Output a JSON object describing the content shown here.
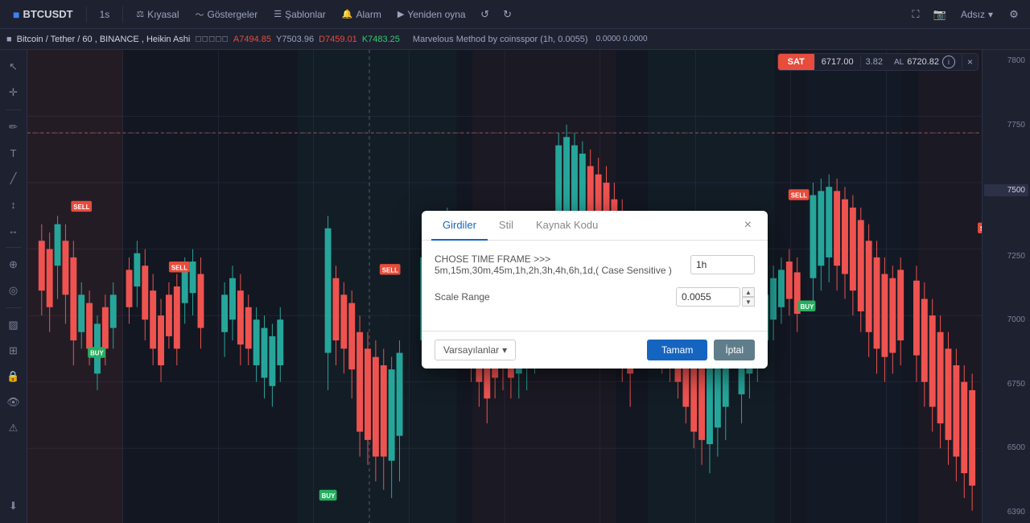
{
  "toolbar": {
    "symbol": "BTCUSDT",
    "timeframe": "1s",
    "kiyasal_label": "Kıyasal",
    "gostergeler_label": "Göstergeler",
    "sablonlar_label": "Şablonlar",
    "alarm_label": "Alarm",
    "yeniden_oyna_label": "Yeniden oyna",
    "adsiz_label": "Adsız"
  },
  "chart_info": {
    "symbol": "Bitcoin / Tether",
    "timeframe": "60",
    "exchange": "BINANCE",
    "type": "Heikin Ashi",
    "a_price": "A7494.85",
    "y_price": "Y7503.96",
    "d_price": "D7459.01",
    "k_price": "K7483.25",
    "indicator": "Marvelous Method by coinsspor (1h, 0.0055)"
  },
  "buy_sell_panel": {
    "sat_label": "SAT",
    "sat_price": "6717.00",
    "spread": "3.82",
    "al_label": "AL",
    "al_price": "6720.82"
  },
  "price_scale": {
    "levels": [
      "7800",
      "7750",
      "7500",
      "7250",
      "7000",
      "6750",
      "6500"
    ]
  },
  "dialog": {
    "title": "Girdiler",
    "tabs": [
      "Girdiler",
      "Stil",
      "Kaynak Kodu"
    ],
    "active_tab": 0,
    "fields": [
      {
        "label": "CHOSE TIME FRAME >>> 5m,15m,30m,45m,1h,2h,3h,4h,6h,1d,( Case Sensitive )",
        "value": "1h",
        "name": "timeframe-input"
      },
      {
        "label": "Scale Range",
        "value": "0.0055",
        "name": "scale-range-input"
      }
    ],
    "defaults_label": "Varsayılanlar",
    "ok_label": "Tamam",
    "cancel_label": "İptal"
  },
  "signals": {
    "sell_labels": [
      "SELL",
      "SELL",
      "SELL",
      "SELL",
      "SELL",
      "SELL",
      "SELL",
      "SELL"
    ],
    "buy_labels": [
      "BUY",
      "BUY",
      "BUY",
      "BUY",
      "BUY"
    ]
  },
  "icons": {
    "cursor": "↖",
    "crosshair": "✛",
    "brush": "✏",
    "text": "T",
    "line": "╱",
    "fibonacci": "~",
    "measure": "↔",
    "zoom": "⊕",
    "magnet": "◎",
    "ruler": "▨",
    "lock": "🔒",
    "eye": "👁",
    "alert": "🔔",
    "layers": "⊞",
    "chevron_down": "▾",
    "undo": "↺",
    "redo": "↻",
    "fullscreen": "⛶",
    "settings": "⚙",
    "screenshot": "📷",
    "info": "i",
    "close": "×"
  }
}
